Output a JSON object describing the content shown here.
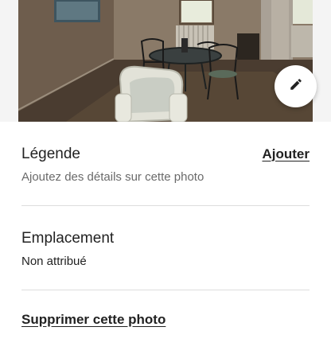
{
  "photo": {
    "subject": "room-with-table-and-chairs",
    "edit_icon": "pencil-icon"
  },
  "caption": {
    "title": "Légende",
    "placeholder": "Ajoutez des détails sur cette photo",
    "action_label": "Ajouter"
  },
  "location": {
    "title": "Emplacement",
    "value": "Non attribué"
  },
  "delete": {
    "label": "Supprimer cette photo"
  },
  "colors": {
    "text": "#222222",
    "secondary_text": "#6a6a6a",
    "divider": "#dddddd",
    "background": "#ffffff"
  }
}
